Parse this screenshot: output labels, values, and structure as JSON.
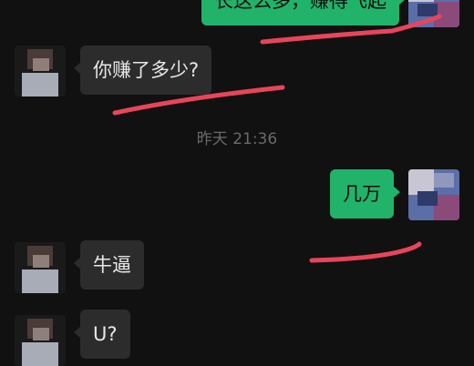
{
  "messages": [
    {
      "side": "out",
      "text": "长这么多，赚得飞起"
    },
    {
      "side": "in",
      "text": "你赚了多少?"
    },
    {
      "side": "out",
      "text": "几万"
    },
    {
      "side": "in",
      "text": "牛逼"
    },
    {
      "side": "in",
      "text": "U?"
    }
  ],
  "timestamp": "昨天 21:36",
  "colors": {
    "background": "#111111",
    "incoming_bubble": "#2c2c2c",
    "outgoing_bubble": "#21b36a",
    "annotation_red": "#e8455a"
  }
}
